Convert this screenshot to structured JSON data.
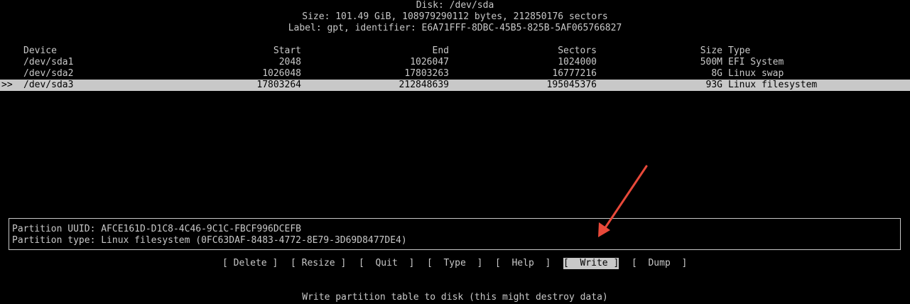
{
  "header": {
    "disk": "Disk: /dev/sda",
    "size": "Size: 101.49 GiB, 108979290112 bytes, 212850176 sectors",
    "label": "Label: gpt, identifier: E6A71FFF-8DBC-45B5-825B-5AF065766827"
  },
  "table": {
    "columns": {
      "device": "Device",
      "start": "Start",
      "end": "End",
      "sectors": "Sectors",
      "size": "Size",
      "type": "Type"
    },
    "selection_marker": ">>",
    "rows": [
      {
        "device": "/dev/sda1",
        "start": "2048",
        "end": "1026047",
        "sectors": "1024000",
        "size": "500M",
        "type": "EFI System"
      },
      {
        "device": "/dev/sda2",
        "start": "1026048",
        "end": "17803263",
        "sectors": "16777216",
        "size": "8G",
        "type": "Linux swap"
      },
      {
        "device": "/dev/sda3",
        "start": "17803264",
        "end": "212848639",
        "sectors": "195045376",
        "size": "93G",
        "type": "Linux filesystem"
      }
    ]
  },
  "info": {
    "uuid": "Partition UUID: AFCE161D-D1C8-4C46-9C1C-FBCF996DCEFB",
    "type": "Partition type: Linux filesystem (0FC63DAF-8483-4772-8E79-3D69D8477DE4)"
  },
  "menu": {
    "delete": "[ Delete ]",
    "resize": "[ Resize ]",
    "quit": "[  Quit  ]",
    "type": "[  Type  ]",
    "help": "[  Help  ]",
    "write": "[  Write ]",
    "dump": "[  Dump  ]"
  },
  "status": "Write partition table to disk (this might destroy data)",
  "colors": {
    "background": "#000000",
    "foreground": "#c8c8c8",
    "highlight": "#c8c8c8",
    "arrow": "#e8493a"
  },
  "icons": {
    "annotation": "red-arrow-icon"
  }
}
